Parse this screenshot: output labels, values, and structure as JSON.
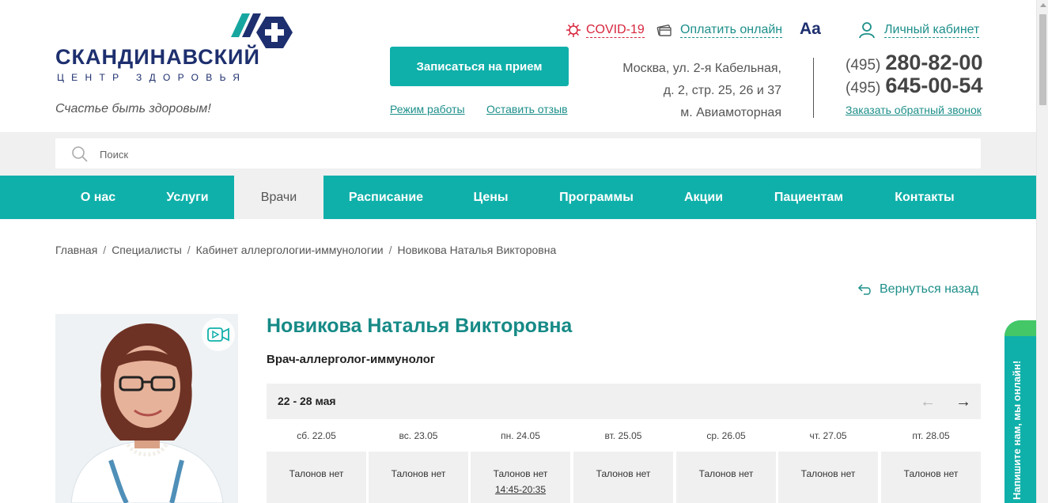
{
  "header": {
    "logo_title": "СКАНДИНАВСКИЙ",
    "logo_subtitle": "ЦЕНТР ЗДОРОВЬЯ",
    "slogan": "Счастье быть здоровым!",
    "covid_label": "COVID-19",
    "pay_label": "Оплатить онлайн",
    "font_size_label": "Aa",
    "cabinet_label": "Личный кабинет",
    "appointment_button": "Записаться на прием",
    "hours_link": "Режим работы",
    "review_link": "Оставить отзыв",
    "address": {
      "line1": "Москва, ул. 2-я Кабельная,",
      "line2": "д. 2, стр. 25, 26 и 37",
      "line3": "м. Авиамоторная"
    },
    "phones": [
      {
        "code": "(495)",
        "number": "280-82-00"
      },
      {
        "code": "(495)",
        "number": "645-00-54"
      }
    ],
    "callback_link": "Заказать обратный звонок"
  },
  "search": {
    "placeholder": "Поиск"
  },
  "nav": {
    "items": [
      {
        "label": "О нас"
      },
      {
        "label": "Услуги"
      },
      {
        "label": "Врачи"
      },
      {
        "label": "Расписание"
      },
      {
        "label": "Цены"
      },
      {
        "label": "Программы"
      },
      {
        "label": "Акции"
      },
      {
        "label": "Пациентам"
      },
      {
        "label": "Контакты"
      }
    ],
    "active": "Врачи"
  },
  "breadcrumb": [
    "Главная",
    "Специалисты",
    "Кабинет аллергологии-иммунологии",
    "Новикова Наталья Викторовна"
  ],
  "back_label": "Вернуться назад",
  "doctor": {
    "name": "Новикова Наталья Викторовна",
    "specialty": "Врач-аллерголог-иммунолог"
  },
  "schedule": {
    "week_label": "22 - 28 мая",
    "prev_arrow": "←",
    "next_arrow": "→",
    "days": [
      {
        "date": "сб. 22.05",
        "status": "Талонов нет",
        "time": ""
      },
      {
        "date": "вс. 23.05",
        "status": "Талонов нет",
        "time": ""
      },
      {
        "date": "пн. 24.05",
        "status": "Талонов нет",
        "time": "14:45-20:35"
      },
      {
        "date": "вт. 25.05",
        "status": "Талонов нет",
        "time": ""
      },
      {
        "date": "ср. 26.05",
        "status": "Талонов нет",
        "time": ""
      },
      {
        "date": "чт. 27.05",
        "status": "Талонов нет",
        "time": ""
      },
      {
        "date": "пт. 28.05",
        "status": "Талонов нет",
        "time": ""
      }
    ]
  },
  "chat_widget_label": "Напишите нам, мы онлайн!",
  "colors": {
    "teal": "#10b0aa",
    "navy": "#1d2f6e",
    "covid_red": "#d7263d",
    "link_teal": "#1d8f8a"
  },
  "icons": [
    "covid-icon",
    "card-icon",
    "user-icon",
    "search-icon",
    "back-arrow-icon",
    "video-icon"
  ]
}
